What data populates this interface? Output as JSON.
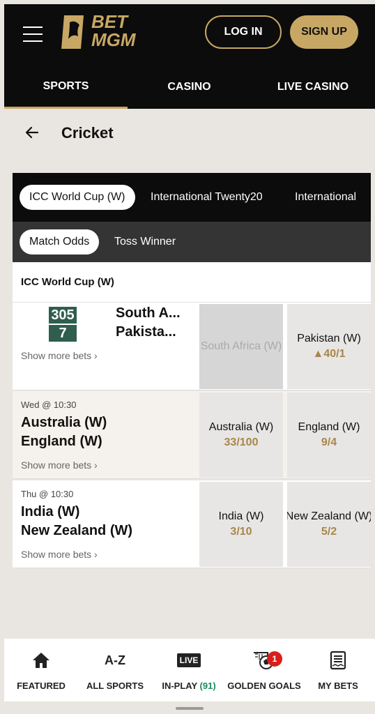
{
  "header": {
    "logo_top": "BET",
    "logo_bottom": "MGM",
    "login_label": "LOG IN",
    "signup_label": "SIGN UP"
  },
  "topnav": [
    {
      "label": "SPORTS",
      "active": true
    },
    {
      "label": "CASINO",
      "active": false
    },
    {
      "label": "LIVE CASINO",
      "active": false
    }
  ],
  "page": {
    "title": "Cricket"
  },
  "competitions": [
    {
      "label": "ICC World Cup (W)",
      "active": true
    },
    {
      "label": "International Twenty20",
      "active": false
    },
    {
      "label": "International",
      "active": false
    }
  ],
  "markets": [
    {
      "label": "Match Odds",
      "active": true
    },
    {
      "label": "Toss Winner",
      "active": false
    }
  ],
  "league": {
    "title": "ICC World Cup (W)"
  },
  "events": [
    {
      "live": true,
      "score": [
        "305",
        "7"
      ],
      "teams": [
        "South A...",
        "Pakista..."
      ],
      "more": "Show more bets ›",
      "odds": [
        {
          "label": "South Africa (W)",
          "price": "",
          "disabled": true
        },
        {
          "label": "Pakistan (W)",
          "price": "▲40/1",
          "disabled": false
        }
      ]
    },
    {
      "live": false,
      "time": "Wed @ 10:30",
      "teams": [
        "Australia (W)",
        "England (W)"
      ],
      "more": "Show more bets ›",
      "odds": [
        {
          "label": "Australia (W)",
          "price": "33/100"
        },
        {
          "label": "England (W)",
          "price": "9/4"
        }
      ]
    },
    {
      "live": false,
      "time": "Thu @ 10:30",
      "teams": [
        "India (W)",
        "New Zealand (W)"
      ],
      "more": "Show more bets ›",
      "odds": [
        {
          "label": "India (W)",
          "price": "3/10"
        },
        {
          "label": "New Zealand (W)",
          "price": "5/2"
        }
      ]
    }
  ],
  "bottom_nav": [
    {
      "label": "FEATURED",
      "icon": "home-icon"
    },
    {
      "label": "ALL SPORTS",
      "icon": "az-icon",
      "icon_text": "A-Z"
    },
    {
      "label": "IN-PLAY",
      "count": "(91)",
      "icon": "live-icon",
      "icon_text": "LIVE"
    },
    {
      "label": "GOLDEN GOALS",
      "icon": "golden-goals-icon",
      "badge": "1"
    },
    {
      "label": "MY BETS",
      "icon": "betslip-icon"
    }
  ],
  "colors": {
    "accent": "#c8a764",
    "header": "#0c0c0c",
    "live_score": "#2f5d4e",
    "badge": "#d7201b"
  }
}
